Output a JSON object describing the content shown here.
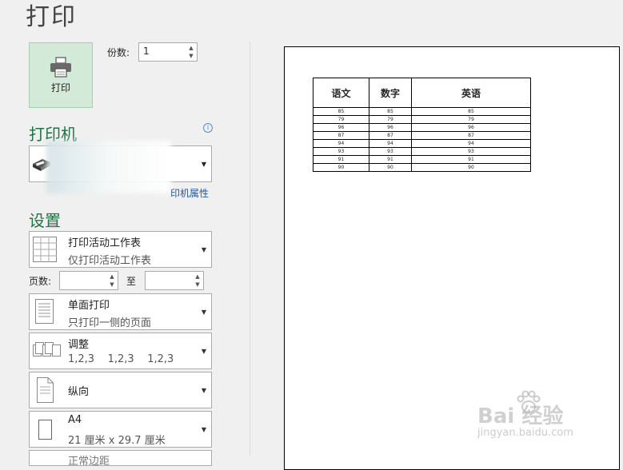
{
  "page": {
    "title": "打印"
  },
  "print_button": {
    "label": "打印"
  },
  "copies": {
    "label": "份数:",
    "value": "1"
  },
  "printer": {
    "heading": "打印机",
    "properties_link": "印机属性"
  },
  "settings": {
    "heading": "设置",
    "print_what": {
      "title": "打印活动工作表",
      "subtitle": "仅打印活动工作表"
    },
    "pages": {
      "label": "页数:",
      "separator": "至",
      "from": "",
      "to": ""
    },
    "sides": {
      "title": "单面打印",
      "subtitle": "只打印一侧的页面"
    },
    "collate": {
      "title": "调整",
      "subtitle": "1,2,3    1,2,3    1,2,3"
    },
    "orientation": {
      "title": "纵向"
    },
    "paper": {
      "title": "A4",
      "subtitle": "21 厘米 x 29.7 厘米"
    },
    "partial_next": {
      "title": "正常边距"
    }
  },
  "preview": {
    "headers": [
      "语文",
      "数字",
      "英语"
    ],
    "rows": [
      [
        "85",
        "85",
        "85"
      ],
      [
        "79",
        "79",
        "79"
      ],
      [
        "96",
        "96",
        "96"
      ],
      [
        "87",
        "87",
        "87"
      ],
      [
        "94",
        "94",
        "94"
      ],
      [
        "93",
        "93",
        "93"
      ],
      [
        "91",
        "91",
        "91"
      ],
      [
        "90",
        "90",
        "90"
      ]
    ]
  },
  "watermark": {
    "line1": "Bai 经验",
    "line2": "jingyan.baidu.com"
  }
}
